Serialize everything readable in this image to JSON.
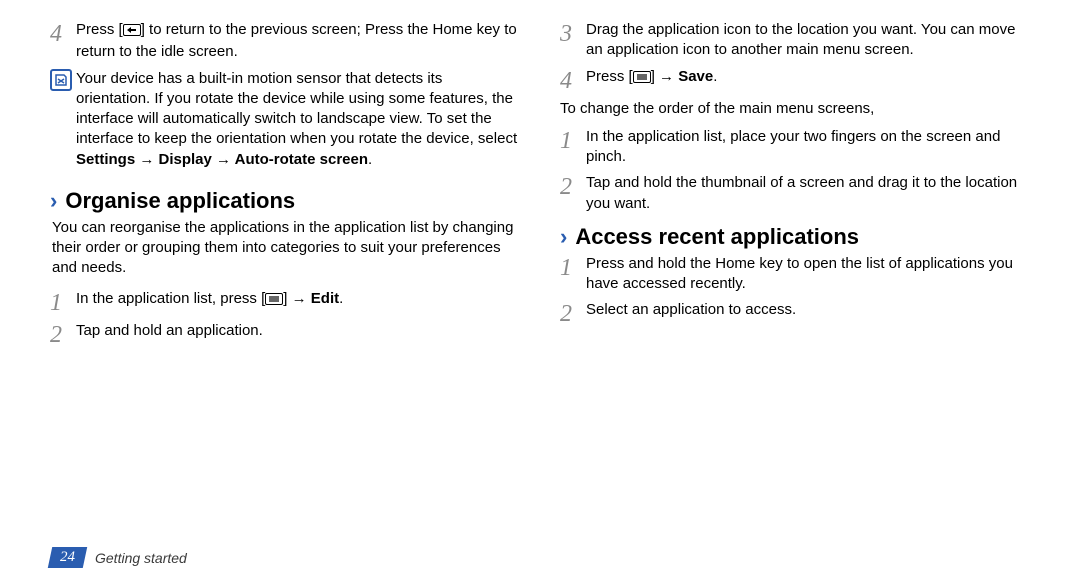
{
  "left": {
    "step4_a": "Press [",
    "step4_b": "] to return to the previous screen; Press the Home key to return to the idle screen.",
    "note_a": "Your device has a built-in motion sensor that detects its orientation. If you rotate the device while using some features, the interface will automatically switch to landscape view. To set the interface to keep the orientation when you rotate the device, select ",
    "note_b": "Settings → Display → Auto-rotate screen",
    "note_c": ".",
    "organise_title": "Organise applications",
    "organise_intro": "You can reorganise the applications in the application list by changing their order or grouping them into categories to suit your preferences and needs.",
    "org1_a": "In the application list, press [",
    "org1_b": "] → ",
    "org1_c": "Edit",
    "org1_d": ".",
    "org2": "Tap and hold an application."
  },
  "right": {
    "step3": "Drag the application icon to the location you want. You can move an application icon to another main menu screen.",
    "step4_a": "Press [",
    "step4_b": "] → ",
    "step4_c": "Save",
    "step4_d": ".",
    "change_intro": "To change the order of the main menu screens,",
    "c1": "In the application list, place your two fingers on the screen and pinch.",
    "c2": "Tap and hold the thumbnail of a screen and drag it to the location you want.",
    "access_title": "Access recent applications",
    "a1": "Press and hold the Home key to open the list of applications you have accessed recently.",
    "a2": "Select an application to access."
  },
  "nums": {
    "n1": "1",
    "n2": "2",
    "n3": "3",
    "n4": "4"
  },
  "footer": {
    "page": "24",
    "section": "Getting started"
  }
}
